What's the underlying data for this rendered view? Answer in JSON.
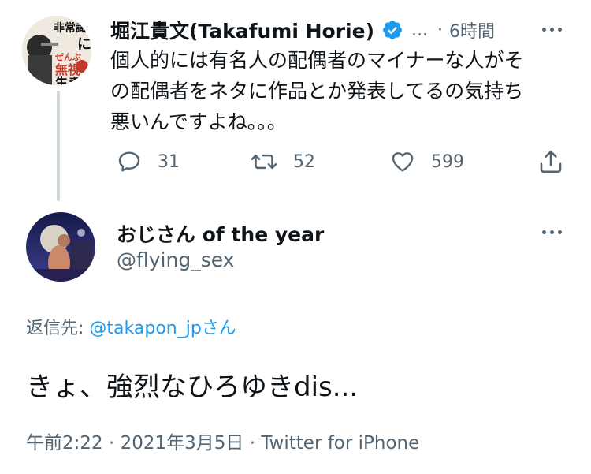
{
  "parent_tweet": {
    "display_name": "堀江貴文(Takafumi Horie)",
    "ellipsis": "...",
    "separator": "·",
    "time": "6時間",
    "text_lines": [
      "個人的には有名人の配偶者のマイナーな人がそ",
      "の配偶者をネタに作品とか発表してるの気持ち",
      "悪いんですよね。。。"
    ],
    "avatar_book_text": [
      "非常識",
      "に",
      "ぜんぶ",
      "無視",
      "生き"
    ],
    "replies": "31",
    "retweets": "52",
    "likes": "599"
  },
  "reply_tweet": {
    "display_name": "おじさん of the year",
    "handle": "@flying_sex",
    "replying_to_label": "返信先: ",
    "replying_to_handle": "@takapon_jp",
    "replying_to_suffix": "さん",
    "text": "きょ、強烈なひろゆきdis...",
    "timestamp": "午前2:22 · 2021年3月5日 · Twitter for iPhone"
  },
  "colors": {
    "accent": "#1d9bf0",
    "muted": "#536471",
    "text": "#0f1419",
    "thread_line": "#cfd9de"
  },
  "icons": [
    "verified-icon",
    "more-icon",
    "reply-icon",
    "retweet-icon",
    "like-icon",
    "share-icon"
  ]
}
